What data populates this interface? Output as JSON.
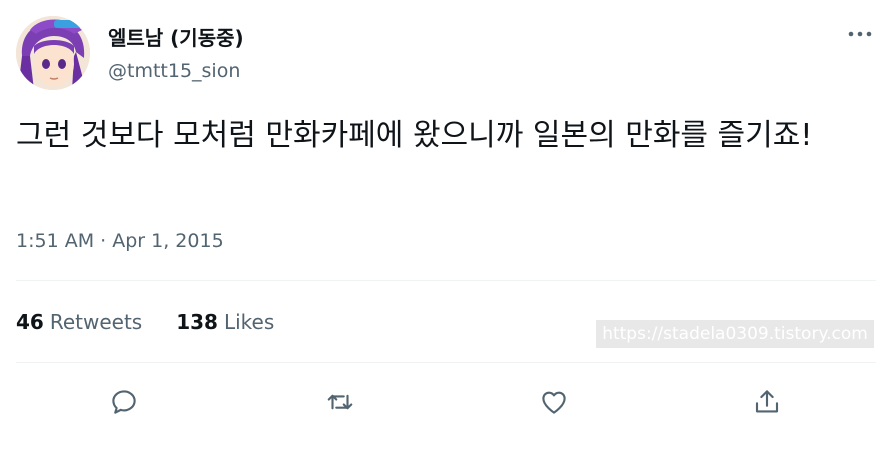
{
  "author": {
    "display_name": "엘트남 (기동중)",
    "handle": "@tmtt15_sion"
  },
  "tweet": {
    "text": "그런 것보다 모처럼 만화카페에 왔으니까 일본의 만화를 즐기죠!",
    "time": "1:51 AM",
    "separator": " · ",
    "date": "Apr 1, 2015"
  },
  "stats": {
    "retweets_count": "46",
    "retweets_label": "Retweets",
    "likes_count": "138",
    "likes_label": "Likes"
  },
  "watermark": "https://stadela0309.tistory.com",
  "icons": {
    "more": "more-dots-icon",
    "reply": "reply-icon",
    "retweet": "retweet-icon",
    "like": "heart-icon",
    "share": "share-icon"
  },
  "colors": {
    "text_primary": "#0f1419",
    "text_secondary": "#536471",
    "divider": "#eff3f4"
  }
}
